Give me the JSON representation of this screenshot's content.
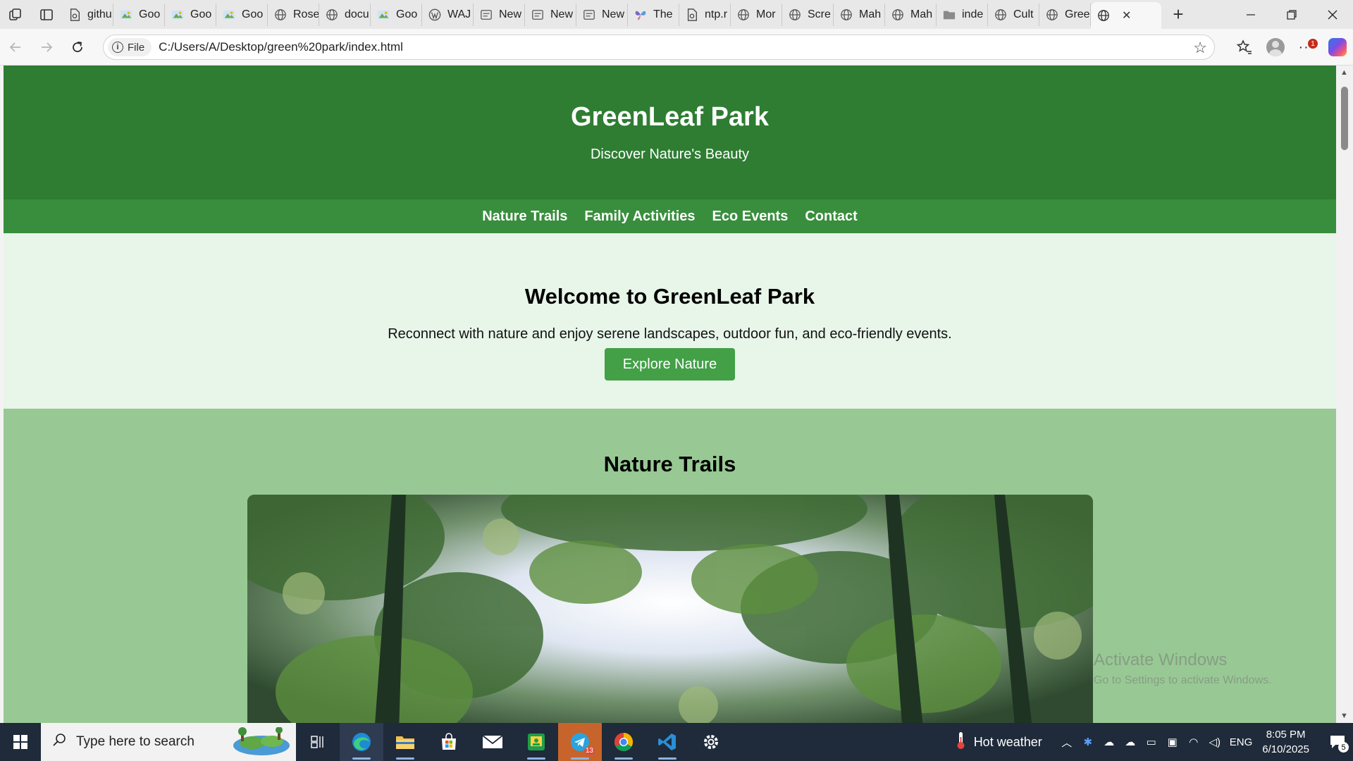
{
  "browser": {
    "tabs": [
      {
        "label": "githu",
        "icon": "document-icon"
      },
      {
        "label": "Goo",
        "icon": "google-drive-icon"
      },
      {
        "label": "Goo",
        "icon": "google-drive-icon"
      },
      {
        "label": "Goo",
        "icon": "google-drive-icon"
      },
      {
        "label": "Rose",
        "icon": "globe-icon"
      },
      {
        "label": "docu",
        "icon": "globe-icon"
      },
      {
        "label": "Goo",
        "icon": "google-drive-icon"
      },
      {
        "label": "WAJ",
        "icon": "wordpress-icon"
      },
      {
        "label": "New",
        "icon": "new-tab-icon"
      },
      {
        "label": "New",
        "icon": "new-tab-icon"
      },
      {
        "label": "New",
        "icon": "new-tab-icon"
      },
      {
        "label": "The",
        "icon": "butterfly-icon"
      },
      {
        "label": "ntp.r",
        "icon": "document-icon"
      },
      {
        "label": "Mor",
        "icon": "globe-icon"
      },
      {
        "label": "Scre",
        "icon": "globe-icon"
      },
      {
        "label": "Mah",
        "icon": "globe-icon"
      },
      {
        "label": "Mah",
        "icon": "globe-icon"
      },
      {
        "label": "inde",
        "icon": "folder-icon"
      },
      {
        "label": "Cult",
        "icon": "globe-icon"
      },
      {
        "label": "Gree",
        "icon": "globe-icon"
      }
    ],
    "active_tab": {
      "label": "",
      "icon": "globe-icon",
      "close": "✕"
    },
    "new_tab": "+",
    "site_chip": "File",
    "url": "C:/Users/A/Desktop/green%20park/index.html",
    "notification_badge": "1"
  },
  "page": {
    "header_title": "GreenLeaf Park",
    "header_tagline": "Discover Nature's Beauty",
    "nav": [
      "Nature Trails",
      "Family Activities",
      "Eco Events",
      "Contact"
    ],
    "hero_title": "Welcome to GreenLeaf Park",
    "hero_text": "Reconnect with nature and enjoy serene landscapes, outdoor fun, and eco-friendly events.",
    "hero_button": "Explore Nature",
    "section_title": "Nature Trails"
  },
  "watermark": {
    "title": "Activate Windows",
    "subtitle": "Go to Settings to activate Windows."
  },
  "taskbar": {
    "search_placeholder": "Type here to search",
    "apps": [
      "task-view",
      "edge",
      "file-explorer",
      "microsoft-store",
      "mail",
      "sheets",
      "telegram",
      "chrome",
      "vscode",
      "settings"
    ],
    "telegram_badge": "13",
    "weather": "Hot weather",
    "language": "ENG",
    "time": "8:05 PM",
    "date": "6/10/2025",
    "notification_count": "5"
  },
  "colors": {
    "header": "#2e7d32",
    "nav": "#388e3c",
    "hero_bg": "#e8f5e9",
    "button": "#43a047",
    "trails_bg": "#98c994"
  }
}
